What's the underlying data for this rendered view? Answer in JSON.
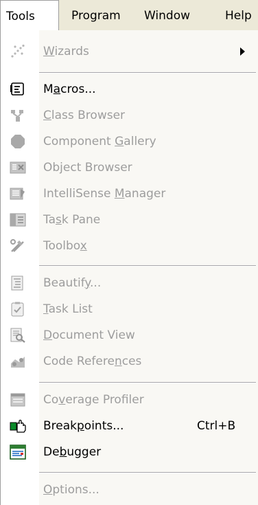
{
  "menubar": {
    "items": [
      {
        "label": "Tools",
        "active": true
      },
      {
        "label": "Program",
        "active": false
      },
      {
        "label": "Window",
        "active": false
      },
      {
        "label": "Help",
        "active": false
      }
    ]
  },
  "menu": {
    "items": [
      {
        "pre": "",
        "mn": "W",
        "post": "izards",
        "enabled": false,
        "submenu": true,
        "icon": "wizard-icon"
      },
      {
        "pre": "M",
        "mn": "a",
        "post": "cros...",
        "enabled": true,
        "icon": "macro-icon"
      },
      {
        "pre": "",
        "mn": "C",
        "post": "lass Browser",
        "enabled": false,
        "icon": "class-browser-icon"
      },
      {
        "pre": "Component ",
        "mn": "G",
        "post": "allery",
        "enabled": false,
        "icon": "component-gallery-icon"
      },
      {
        "pre": "Ob",
        "mn": "j",
        "post": "ect Browser",
        "enabled": false,
        "icon": "object-browser-icon"
      },
      {
        "pre": "IntelliSense ",
        "mn": "M",
        "post": "anager",
        "enabled": false,
        "icon": "intellisense-icon"
      },
      {
        "pre": "Ta",
        "mn": "s",
        "post": "k Pane",
        "enabled": false,
        "icon": "task-pane-icon"
      },
      {
        "pre": "Toolbo",
        "mn": "x",
        "post": "",
        "enabled": false,
        "icon": "toolbox-icon"
      },
      {
        "pre": "Beautif",
        "mn": "y",
        "post": "...",
        "enabled": false,
        "icon": "beautify-icon"
      },
      {
        "pre": "",
        "mn": "T",
        "post": "ask List",
        "enabled": false,
        "icon": "task-list-icon"
      },
      {
        "pre": "",
        "mn": "D",
        "post": "ocument View",
        "enabled": false,
        "icon": "document-view-icon"
      },
      {
        "pre": "Code Refere",
        "mn": "n",
        "post": "ces",
        "enabled": false,
        "icon": "code-references-icon"
      },
      {
        "pre": "Co",
        "mn": "v",
        "post": "erage Profiler",
        "enabled": false,
        "icon": "coverage-profiler-icon"
      },
      {
        "pre": "Break",
        "mn": "p",
        "post": "oints...",
        "enabled": true,
        "shortcut": "Ctrl+B",
        "icon": "breakpoints-icon"
      },
      {
        "pre": "De",
        "mn": "b",
        "post": "ugger",
        "enabled": true,
        "icon": "debugger-icon"
      },
      {
        "pre": "",
        "mn": "O",
        "post": "ptions...",
        "enabled": false,
        "icon": ""
      }
    ]
  }
}
